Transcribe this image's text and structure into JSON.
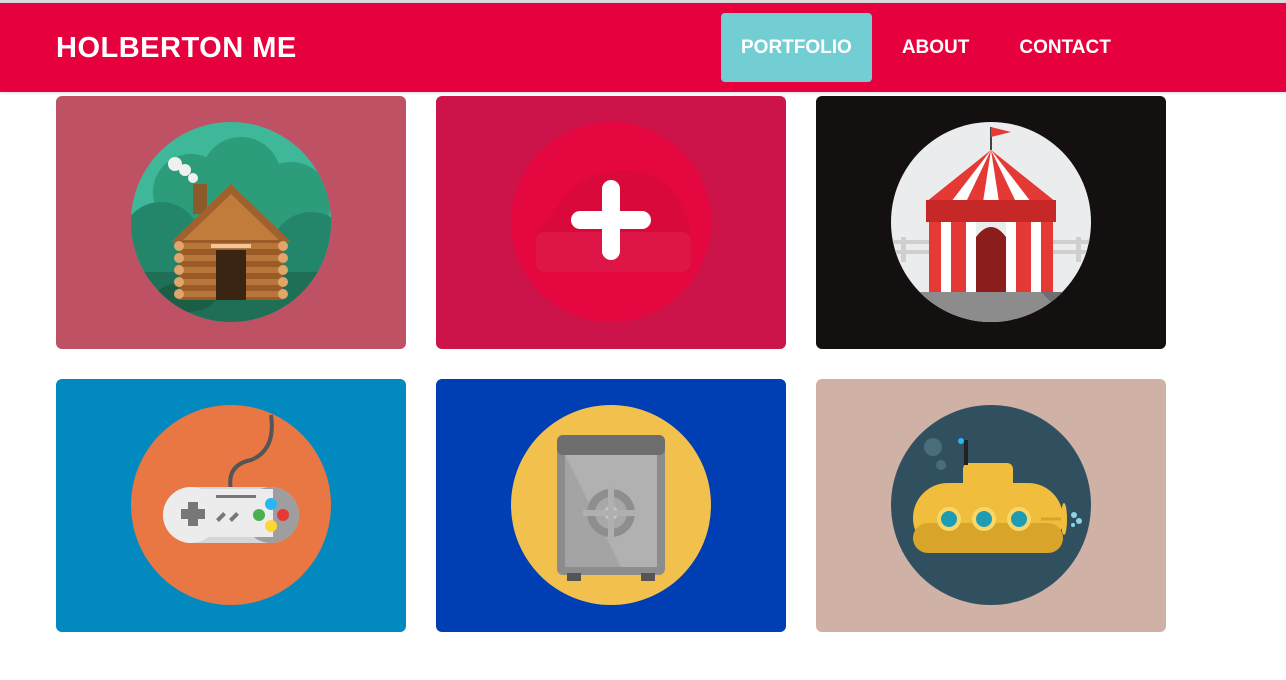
{
  "brand": {
    "title": "HOLBERTON ME"
  },
  "nav": {
    "items": [
      {
        "label": "PORTFOLIO",
        "active": true
      },
      {
        "label": "ABOUT",
        "active": false
      },
      {
        "label": "CONTACT",
        "active": false
      }
    ]
  },
  "portfolio": {
    "cards": [
      {
        "icon": "log-cabin-icon",
        "background": "#bf5165",
        "circle": "#3fb89a"
      },
      {
        "icon": "plus-icon",
        "background": "#cc144a",
        "circle": "#e5073f"
      },
      {
        "icon": "circus-tent-icon",
        "background": "#141010",
        "circle": "#ebecee"
      },
      {
        "icon": "game-controller-icon",
        "background": "#0189c0",
        "circle": "#e87743"
      },
      {
        "icon": "safe-icon",
        "background": "#003eb3",
        "circle": "#f2c14d"
      },
      {
        "icon": "submarine-icon",
        "background": "#cfb1a5",
        "circle": "#31505f"
      }
    ]
  },
  "colors": {
    "header": "#e7003e",
    "active_tab": "#73ced4",
    "text": "#ffffff"
  }
}
